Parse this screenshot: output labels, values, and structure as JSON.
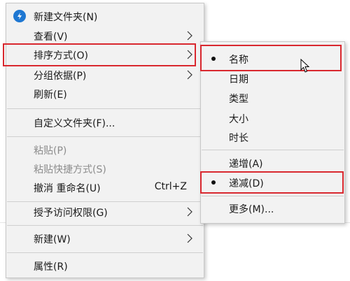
{
  "context_menu": {
    "items": {
      "new_folder": {
        "label": "新建文件夹(N)",
        "icon": "new-folder-icon"
      },
      "view": {
        "label": "查看(V)"
      },
      "sort_by": {
        "label": "排序方式(O)"
      },
      "group_by": {
        "label": "分组依据(P)"
      },
      "refresh": {
        "label": "刷新(E)"
      },
      "customize_folder": {
        "label": "自定义文件夹(F)..."
      },
      "paste": {
        "label": "粘贴(P)"
      },
      "paste_shortcut": {
        "label": "粘贴快捷方式(S)"
      },
      "undo_rename": {
        "label": "撤消 重命名(U)",
        "shortcut": "Ctrl+Z"
      },
      "grant_access": {
        "label": "授予访问权限(G)"
      },
      "new": {
        "label": "新建(W)"
      },
      "properties": {
        "label": "属性(R)"
      }
    }
  },
  "sort_submenu": {
    "items": {
      "name": {
        "label": "名称",
        "checked": true
      },
      "date": {
        "label": "日期"
      },
      "type": {
        "label": "类型"
      },
      "size": {
        "label": "大小"
      },
      "duration": {
        "label": "时长"
      },
      "ascending": {
        "label": "递增(A)"
      },
      "descending": {
        "label": "递减(D)",
        "checked": true
      },
      "more": {
        "label": "更多(M)..."
      }
    }
  },
  "highlight_color": "#d9282f"
}
